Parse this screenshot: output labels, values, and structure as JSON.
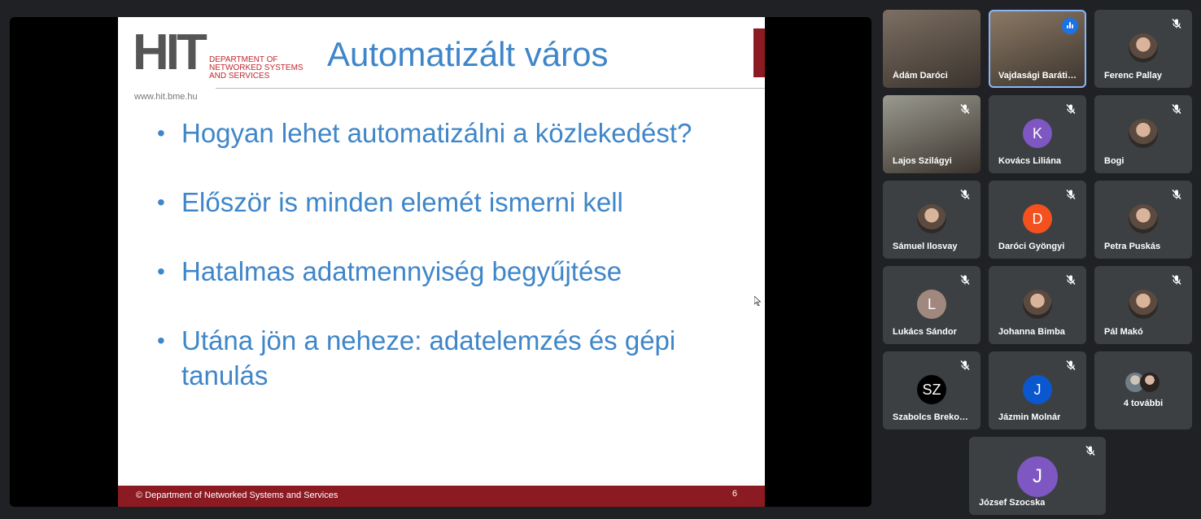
{
  "slide": {
    "logo_text": "HIT",
    "logo_dept": [
      "DEPARTMENT OF",
      "NETWORKED SYSTEMS",
      "AND SERVICES"
    ],
    "logo_url": "www.hit.bme.hu",
    "title": "Automatizált város",
    "bullets": [
      "Hogyan lehet automatizálni a közlekedést?",
      "Először is minden elemét ismerni kell",
      "Hatalmas adatmennyiség begyűjtése",
      "Utána jön a neheze: adatelemzés és gépi tanulás"
    ],
    "footer": "© Department of Networked Systems and Services",
    "page_number": "6"
  },
  "participants": [
    {
      "name": "Ádám Daróci",
      "muted": false,
      "kind": "photo"
    },
    {
      "name": "Vajdasági Baráti ...",
      "muted": false,
      "kind": "photo",
      "speaking": true
    },
    {
      "name": "Ferenc Pallay",
      "muted": true,
      "kind": "pic"
    },
    {
      "name": "Lajos Szilágyi",
      "muted": true,
      "kind": "photo"
    },
    {
      "name": "Kovács Liliána",
      "muted": true,
      "kind": "letter",
      "letter": "K",
      "color": "#7e57c2"
    },
    {
      "name": "Bogi",
      "muted": true,
      "kind": "pic"
    },
    {
      "name": "Sámuel Ilosvay",
      "muted": true,
      "kind": "pic"
    },
    {
      "name": "Daróci Gyöngyi",
      "muted": true,
      "kind": "letter",
      "letter": "D",
      "color": "#f4511e"
    },
    {
      "name": "Petra Puskás",
      "muted": true,
      "kind": "pic"
    },
    {
      "name": "Lukács Sándor",
      "muted": true,
      "kind": "letter",
      "letter": "L",
      "color": "#a1887f"
    },
    {
      "name": "Johanna Bimba",
      "muted": true,
      "kind": "pic"
    },
    {
      "name": "Pál Makó",
      "muted": true,
      "kind": "pic"
    },
    {
      "name": "Szabolcs Brekov...",
      "muted": true,
      "kind": "letter",
      "letter": "SZ",
      "color": "#000000"
    },
    {
      "name": "Jázmin Molnár",
      "muted": true,
      "kind": "letter",
      "letter": "J",
      "color": "#0b57d0"
    },
    {
      "name": "József Szocska",
      "muted": true,
      "kind": "letter",
      "letter": "J",
      "color": "#7e57c2"
    }
  ],
  "more": {
    "label": "4 további"
  },
  "colors": {
    "accent": "#3f86c9",
    "brand_red": "#8b1a22",
    "tile_bg": "#3c4043",
    "speaking": "#8ab4f8"
  },
  "icons": {
    "muted": "mic-off-icon",
    "speaking": "audio-level-icon"
  }
}
